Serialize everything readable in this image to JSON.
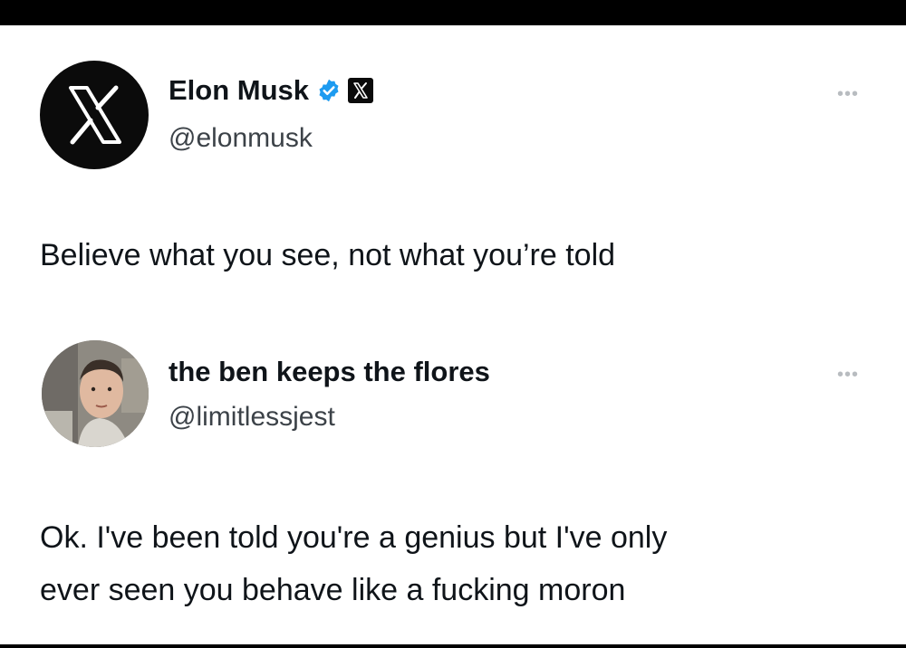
{
  "tweet": {
    "author": {
      "name": "Elon Musk",
      "handle": "@elonmusk",
      "avatar_icon": "x-logo-icon",
      "verified_icon": "verified-badge-icon",
      "affiliation_icon": "x-affiliation-badge-icon"
    },
    "text": "Believe what you see, not what you’re told",
    "more_icon": "more-options-icon"
  },
  "reply": {
    "author": {
      "name": "the ben keeps the flores",
      "handle": "@limitlessjest",
      "avatar_icon": "user-photo-avatar"
    },
    "text_lines": [
      "Ok. I've been told you're a genius but I've only",
      "ever seen you behave like a fucking moron"
    ],
    "more_icon": "more-options-icon"
  },
  "colors": {
    "verified_blue": "#1d9bf0",
    "text": "#0f1419",
    "secondary_text": "#536471"
  }
}
